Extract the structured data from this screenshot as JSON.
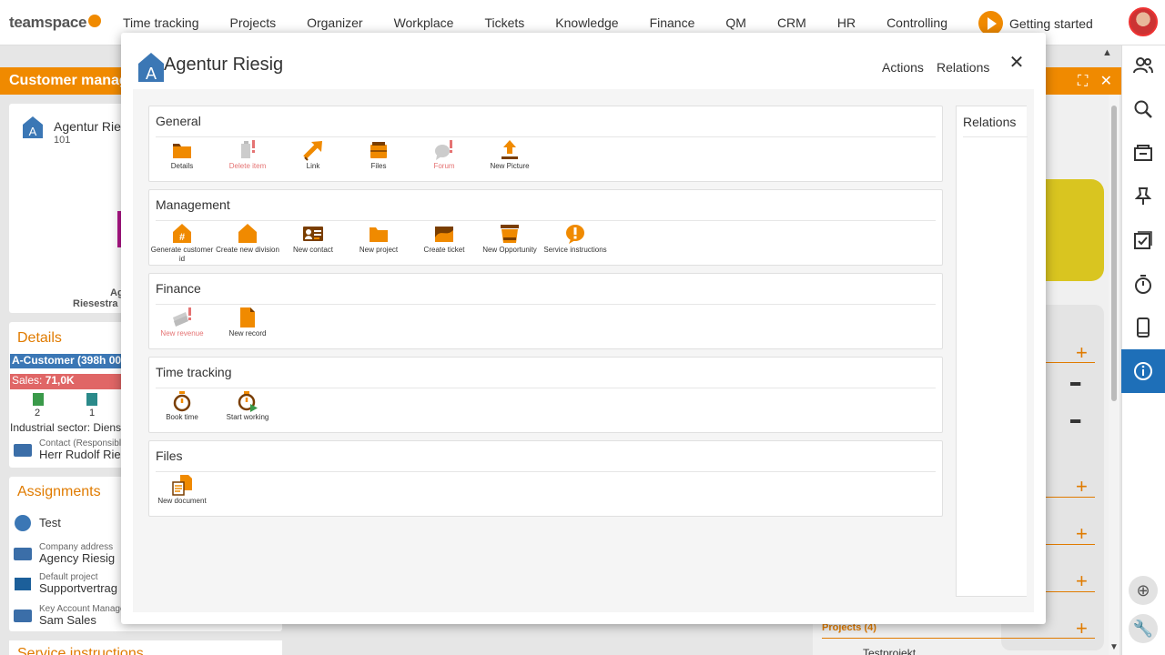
{
  "app": {
    "logo_text": "teamspace",
    "nav": [
      "Time tracking",
      "Projects",
      "Organizer",
      "Workplace",
      "Tickets",
      "Knowledge",
      "Finance",
      "QM",
      "CRM",
      "HR",
      "Controlling"
    ],
    "getting_started": "Getting started"
  },
  "background": {
    "header_title": "Customer manag",
    "company_name": "Agentur Ries",
    "company_id": "101",
    "address_line1": "Ag",
    "address_line2": "Riesestra",
    "details_title": "Details",
    "a_customer": "A-Customer (398h 00",
    "sales_label": "Sales:",
    "sales_value": "71,0K",
    "count_1": "2",
    "count_2": "1",
    "industry": "Industrial sector: Dienst",
    "contact_label": "Contact (Responsible)",
    "contact_value": "Herr Rudolf Ries",
    "assignments_title": "Assignments",
    "assign_test": "Test",
    "company_address_label": "Company address",
    "company_address_value": "Agency Riesig",
    "default_project_label": "Default project",
    "default_project_value": "Supportvertrag",
    "kam_label": "Key Account Manager",
    "kam_value": "Sam Sales",
    "service_title": "Service instructions",
    "projects_label": "Projects (4)",
    "test_project": "Testprojekt"
  },
  "modal": {
    "logo_letter": "A",
    "title": "Agentur Riesig",
    "actions": "Actions",
    "relations": "Relations",
    "relations_panel_title": "Relations",
    "sections": [
      {
        "title": "General",
        "items": [
          {
            "label": "Details",
            "icon": "folder-icon",
            "disabled": false
          },
          {
            "label": "Delete item",
            "icon": "delete-icon",
            "disabled": true
          },
          {
            "label": "Link",
            "icon": "link-arrow-icon",
            "disabled": false
          },
          {
            "label": "Files",
            "icon": "files-icon",
            "disabled": false
          },
          {
            "label": "Forum",
            "icon": "forum-icon",
            "disabled": true
          },
          {
            "label": "New Picture",
            "icon": "upload-icon",
            "disabled": false
          }
        ]
      },
      {
        "title": "Management",
        "items": [
          {
            "label": "Generate customer id",
            "icon": "hash-icon",
            "disabled": false
          },
          {
            "label": "Create new division",
            "icon": "house-icon",
            "disabled": false
          },
          {
            "label": "New contact",
            "icon": "contact-card-icon",
            "disabled": false
          },
          {
            "label": "New project",
            "icon": "project-folder-icon",
            "disabled": false
          },
          {
            "label": "Create ticket",
            "icon": "ticket-icon",
            "disabled": false
          },
          {
            "label": "New Opportunity",
            "icon": "opportunity-icon",
            "disabled": false
          },
          {
            "label": "Service instructions",
            "icon": "alert-icon",
            "disabled": false
          }
        ]
      },
      {
        "title": "Finance",
        "items": [
          {
            "label": "New revenue",
            "icon": "revenue-icon",
            "disabled": true
          },
          {
            "label": "New record",
            "icon": "record-icon",
            "disabled": false
          }
        ]
      },
      {
        "title": "Time tracking",
        "items": [
          {
            "label": "Book time",
            "icon": "stopwatch-icon",
            "disabled": false
          },
          {
            "label": "Start working",
            "icon": "stopwatch-play-icon",
            "disabled": false
          }
        ]
      },
      {
        "title": "Files",
        "items": [
          {
            "label": "New document",
            "icon": "document-icon",
            "disabled": false
          }
        ]
      }
    ]
  },
  "colors": {
    "accent": "#f08a00",
    "accent_text": "#e07b00",
    "brand_blue": "#3b77b5",
    "active_rail": "#1e6fb8",
    "disabled_label": "#e57373"
  },
  "rail_icons": [
    "people-icon",
    "search-icon",
    "inbox-icon",
    "pin-icon",
    "checklist-icon",
    "timer-icon",
    "mobile-icon",
    "info-icon"
  ]
}
